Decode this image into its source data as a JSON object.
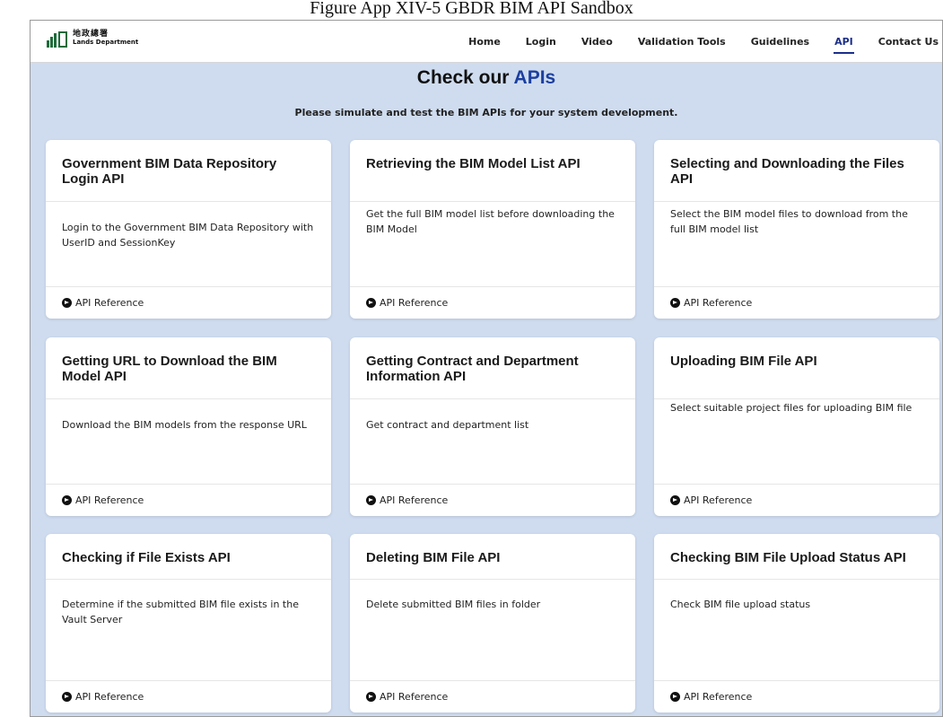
{
  "figure_caption": "Figure App XIV-5 GBDR BIM API Sandbox",
  "logo": {
    "chinese": "地政總署",
    "english": "Lands Department",
    "icon": "lands-department-logo"
  },
  "nav": {
    "items": [
      {
        "label": "Home"
      },
      {
        "label": "Login"
      },
      {
        "label": "Video"
      },
      {
        "label": "Validation Tools"
      },
      {
        "label": "Guidelines"
      },
      {
        "label": "API",
        "active": true
      },
      {
        "label": "Contact Us"
      }
    ]
  },
  "hero": {
    "title_prefix": "Check our ",
    "title_accent": "APIs",
    "subtitle": "Please simulate and test the BIM APIs for your system development."
  },
  "api_reference_label": "API Reference",
  "cards": [
    {
      "title": "Government BIM Data Repository Login API",
      "description": "Login to the Government BIM Data Repository with UserID and SessionKey",
      "link": "API Reference"
    },
    {
      "title": "Retrieving the BIM Model List API",
      "description": "Get the full BIM model list before downloading the BIM Model",
      "link": "API Reference"
    },
    {
      "title": "Selecting and Downloading the Files API",
      "description": "Select the BIM model files to download from the full BIM model list",
      "link": "API Reference"
    },
    {
      "title": "Getting URL to Download the BIM Model API",
      "description": "Download the BIM models from the response URL",
      "link": "API Reference"
    },
    {
      "title": "Getting Contract and Department Information API",
      "description": "Get contract and department list",
      "link": "API Reference"
    },
    {
      "title": "Uploading BIM File API",
      "description": "Select suitable project files for uploading BIM file",
      "link": "API Reference"
    },
    {
      "title": "Checking if File Exists API",
      "description": "Determine if the submitted BIM file exists in the Vault Server",
      "link": "API Reference"
    },
    {
      "title": "Deleting BIM File API",
      "description": "Delete submitted BIM files in folder",
      "link": "API Reference"
    },
    {
      "title": "Checking BIM File Upload Status API",
      "description": "Check BIM file upload status",
      "link": "API Reference"
    }
  ],
  "colors": {
    "accent": "#1b3fa0",
    "page_background": "#cfdcef",
    "active_nav": "#1b2f8a"
  }
}
